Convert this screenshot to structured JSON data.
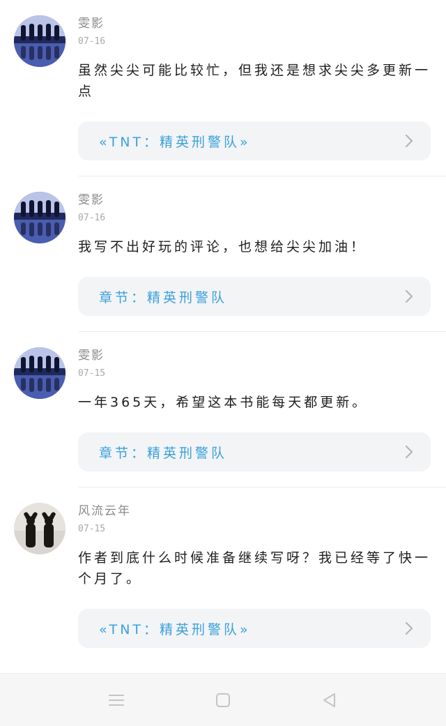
{
  "comments": [
    {
      "username": "雯影",
      "date": "07-16",
      "text": "虽然尖尖可能比较忙，但我还是想求尖尖多更新一点",
      "ref": {
        "label": "«TNT：精英刑警队»",
        "kind": "book"
      }
    },
    {
      "username": "雯影",
      "date": "07-16",
      "text": "我写不出好玩的评论，也想给尖尖加油！",
      "ref": {
        "label": "章节：精英刑警队",
        "kind": "chapter"
      }
    },
    {
      "username": "雯影",
      "date": "07-15",
      "text": "一年365天，希望这本书能每天都更新。",
      "ref": {
        "label": "章节：精英刑警队",
        "kind": "chapter"
      }
    },
    {
      "username": "风流云年",
      "date": "07-15",
      "text": "作者到底什么时候准备继续写呀？我已经等了快一个月了。",
      "ref": {
        "label": "«TNT：精英刑警队»",
        "kind": "book"
      }
    }
  ],
  "icons": {
    "chevron": "chevron-right-icon",
    "nav_menu": "menu-icon",
    "nav_home": "home-square-icon",
    "nav_back": "back-triangle-icon"
  },
  "colors": {
    "link": "#3aa0dc",
    "card_bg": "#f2f4f6",
    "meta": "#8a8a8a"
  }
}
